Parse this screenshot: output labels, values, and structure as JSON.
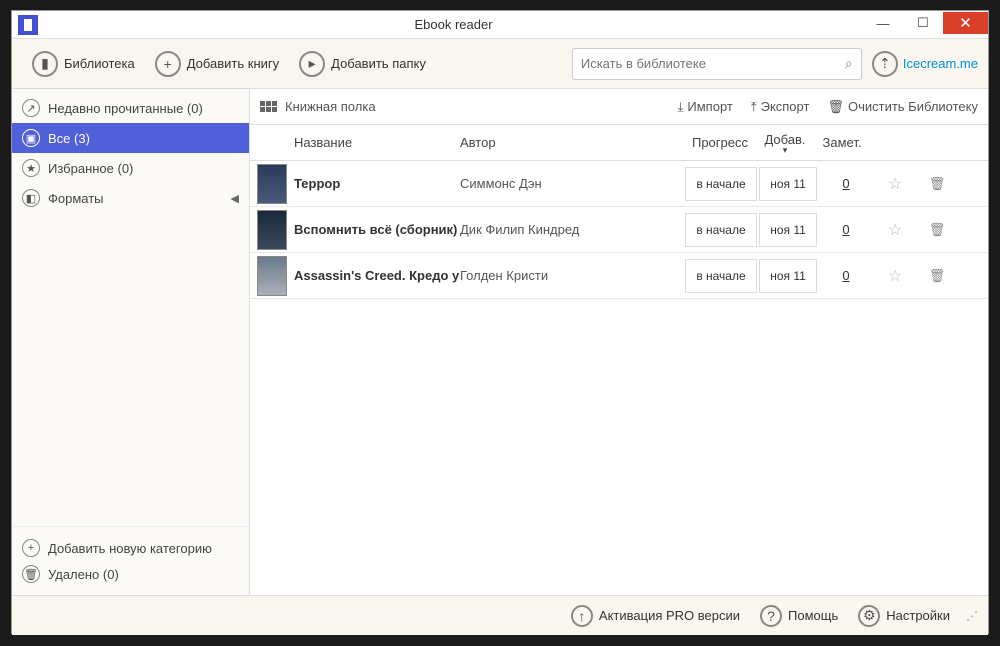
{
  "window": {
    "title": "Ebook reader"
  },
  "toolbar": {
    "library": "Библиотека",
    "add_book": "Добавить книгу",
    "add_folder": "Добавить папку"
  },
  "search": {
    "placeholder": "Искать в библиотеке"
  },
  "icecream_link": "Icecream.me",
  "sidebar": {
    "items": [
      {
        "label": "Недавно прочитанные (0)",
        "icon": "↗"
      },
      {
        "label": "Все (3)",
        "icon": "▣"
      },
      {
        "label": "Избранное (0)",
        "icon": "★"
      },
      {
        "label": "Форматы",
        "icon": "◧",
        "has_chevron": true
      }
    ],
    "add_category": "Добавить новую категорию",
    "deleted": "Удалено (0)"
  },
  "shelf": {
    "label": "Книжная полка",
    "import": "Импорт",
    "export": "Экспорт",
    "clear": "Очистить Библиотеку"
  },
  "columns": {
    "title": "Название",
    "author": "Автор",
    "progress": "Прогресс",
    "added": "Добав.",
    "notes": "Замет."
  },
  "books": [
    {
      "title": "Террор",
      "author": "Симмонс Дэн",
      "progress": "в начале",
      "date": "ноя 11",
      "notes": "0"
    },
    {
      "title": "Вспомнить всё (сборник)",
      "author": "Дик Филип Киндред",
      "progress": "в начале",
      "date": "ноя 11",
      "notes": "0"
    },
    {
      "title": "Assassin's Creed. Кредо убийцы",
      "author": "Голден Кристи",
      "progress": "в начале",
      "date": "ноя 11",
      "notes": "0"
    }
  ],
  "statusbar": {
    "activate": "Активация PRO версии",
    "help": "Помощь",
    "settings": "Настройки"
  }
}
